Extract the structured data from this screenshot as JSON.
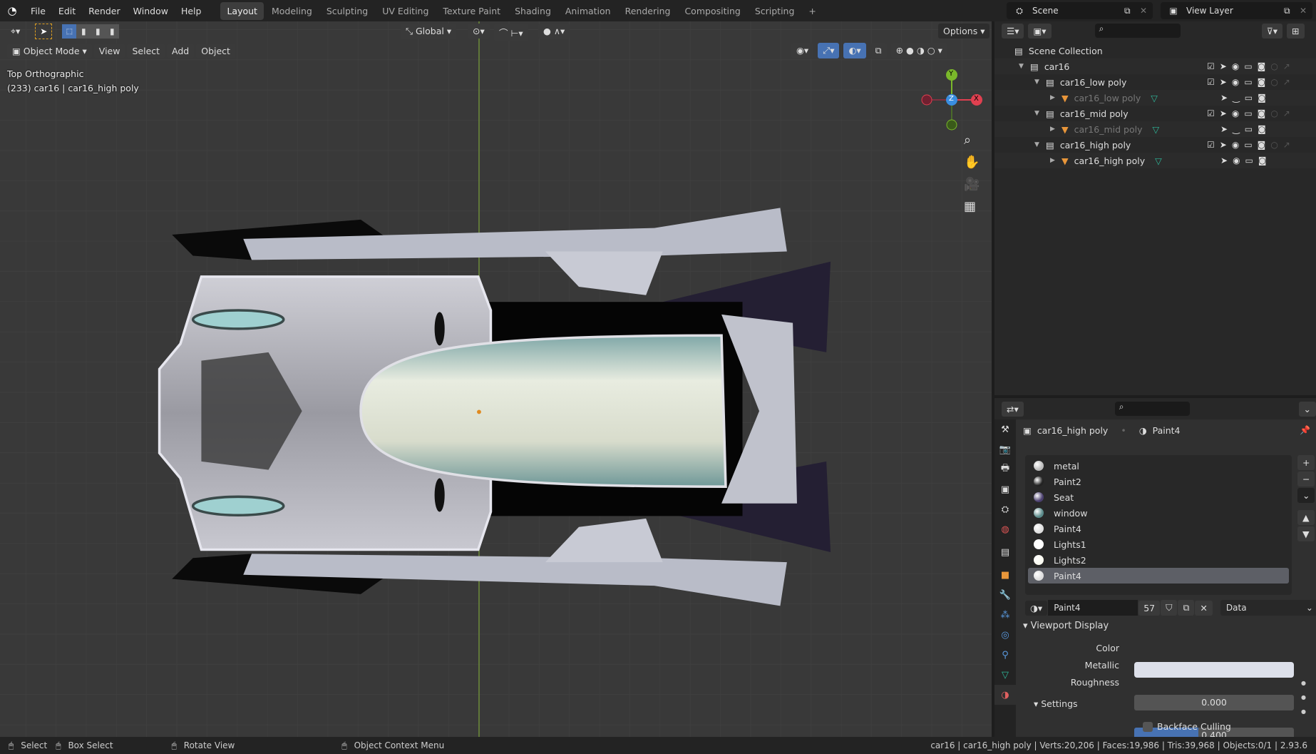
{
  "menu": [
    "File",
    "Edit",
    "Render",
    "Window",
    "Help"
  ],
  "workspaces": [
    "Layout",
    "Modeling",
    "Sculpting",
    "UV Editing",
    "Texture Paint",
    "Shading",
    "Animation",
    "Rendering",
    "Compositing",
    "Scripting"
  ],
  "scene": "Scene",
  "view_layer": "View Layer",
  "toolbar": {
    "orientation": "Global",
    "options": "Options"
  },
  "viewport_header": {
    "mode": "Object Mode",
    "items": [
      "View",
      "Select",
      "Add",
      "Object"
    ]
  },
  "overlay": {
    "view_name": "Top Orthographic",
    "object_info": "(233) car16 | car16_high poly"
  },
  "gizmo": {
    "y": "Y",
    "z": "Z",
    "x": "X"
  },
  "outliner": {
    "root": "Scene Collection",
    "rows": [
      {
        "label": "car16",
        "level": 1,
        "type": "collection"
      },
      {
        "label": "car16_low poly",
        "level": 2,
        "type": "collection"
      },
      {
        "label": "car16_low poly",
        "level": 3,
        "type": "object",
        "dim": true
      },
      {
        "label": "car16_mid poly",
        "level": 2,
        "type": "collection"
      },
      {
        "label": "car16_mid poly",
        "level": 3,
        "type": "object",
        "dim": true
      },
      {
        "label": "car16_high poly",
        "level": 2,
        "type": "collection"
      },
      {
        "label": "car16_high poly",
        "level": 3,
        "type": "object",
        "dim": false
      }
    ]
  },
  "properties": {
    "object": "car16_high poly",
    "material": "Paint4",
    "slots": [
      {
        "name": "metal",
        "color": "#bbbbbb"
      },
      {
        "name": "Paint2",
        "color": "#222222"
      },
      {
        "name": "Seat",
        "color": "#4a3f6e"
      },
      {
        "name": "window",
        "color": "#5a8a8a"
      },
      {
        "name": "Paint4",
        "color": "#dddddd"
      },
      {
        "name": "Lights1",
        "color": "#ffffff"
      },
      {
        "name": "Lights2",
        "color": "#fafaf0"
      },
      {
        "name": "Paint4",
        "color": "#dddddd"
      }
    ],
    "material_name": "Paint4",
    "users": "57",
    "link": "Data",
    "viewport_display": "Viewport Display",
    "color_label": "Color",
    "color_value": "#dde0ea",
    "metallic_label": "Metallic",
    "metallic": "0.000",
    "roughness_label": "Roughness",
    "roughness": "0.400",
    "roughness_fraction": 0.4,
    "settings": "Settings",
    "backface": "Backface Culling"
  },
  "status": {
    "select": "Select",
    "box_select": "Box Select",
    "rotate": "Rotate View",
    "context": "Object Context Menu",
    "stats": "car16 | car16_high poly | Verts:20,206 | Faces:19,986 | Tris:39,968 | Objects:0/1 | 2.93.6"
  }
}
